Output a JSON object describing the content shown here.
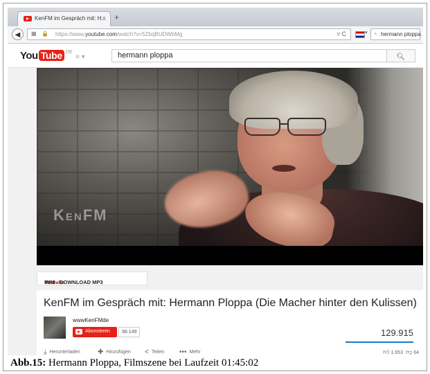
{
  "browser": {
    "tab_title": "KenFM im Gespräch mit: H...",
    "tab_close": "×",
    "new_tab": "+",
    "url_prefix": "https://www.",
    "url_domain": "youtube.com",
    "url_path": "/watch?v=5ZbqBUDWbMg",
    "reload": "▿ C",
    "search_value": "hermann ploppa"
  },
  "youtube": {
    "logo_you": "You",
    "logo_tube": "Tube",
    "logo_country": "DE",
    "guide": "≡ ▾",
    "search_value": "hermann ploppa",
    "search_icon": "search-icon"
  },
  "video": {
    "watermark": "KenFM"
  },
  "banner": {
    "part1": "Fast",
    "part2": "Youtube",
    "part3": "MP3 - DOWNLOAD MP3"
  },
  "meta": {
    "title": "KenFM im Gespräch mit: Hermann Ploppa (Die Macher hinter den Kulissen)",
    "channel": "wwwKenFMde",
    "subscribe_label": "Abonnieren",
    "subscriber_count": "98.149",
    "views": "129.915",
    "actions": {
      "download": "Herunterladen",
      "add": "Hinzufügen",
      "share": "Teilen",
      "more": "Mehr"
    },
    "likes": "1.653",
    "dislikes": "64"
  },
  "caption": {
    "label": "Abb.15:",
    "text": " Hermann Ploppa, Filmszene bei Laufzeit 01:45:02"
  },
  "colors": {
    "youtube_red": "#e62117",
    "view_bar": "#167ac6"
  }
}
